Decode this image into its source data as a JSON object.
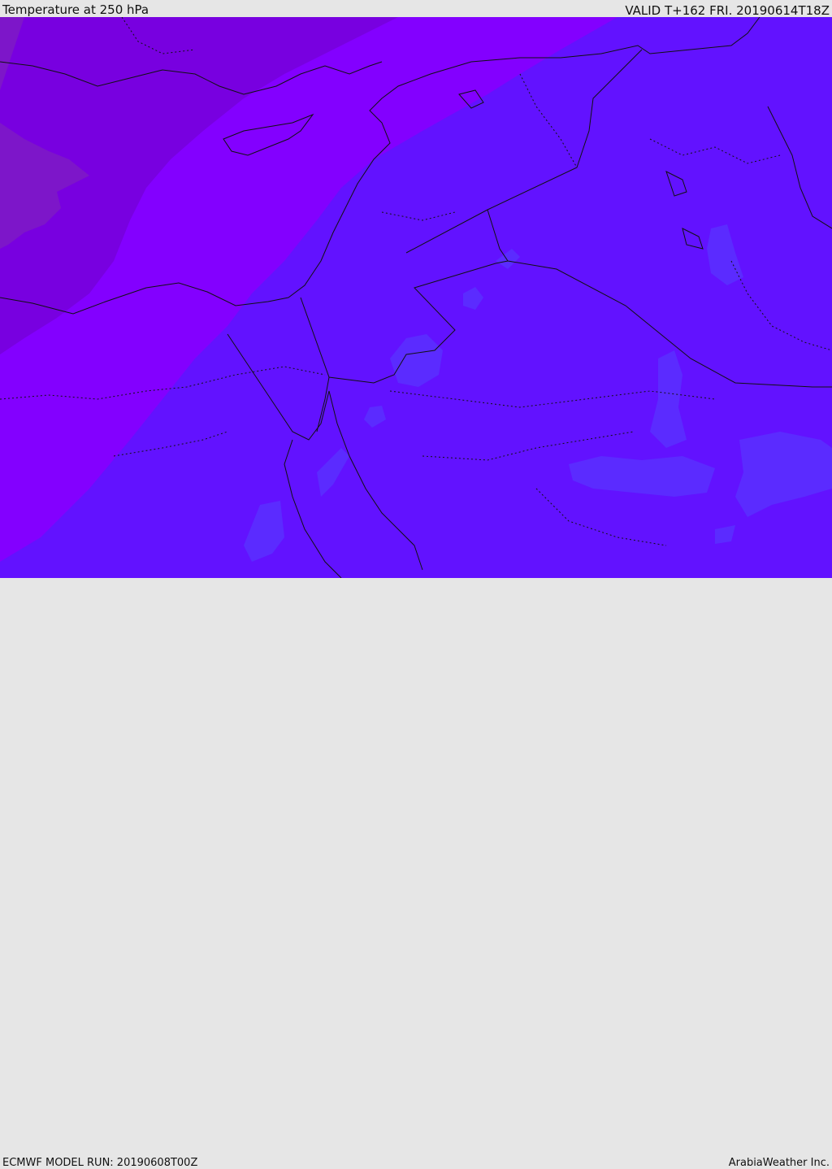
{
  "header": {
    "title": "Temperature at 250 hPa",
    "valid": "VALID T+162 FRI. 20190614T18Z"
  },
  "footer": {
    "model_run": "ECMWF MODEL RUN: 20190608T00Z",
    "credit": "ArabiaWeather Inc."
  },
  "colors": {
    "coldest": "#7d16c9",
    "cold": "#7800e0",
    "mid": "#8300ff",
    "warm": "#6212ff",
    "warmer_patches": "#5b2bff",
    "coast": "#111111",
    "background": "#e6e6e6"
  }
}
